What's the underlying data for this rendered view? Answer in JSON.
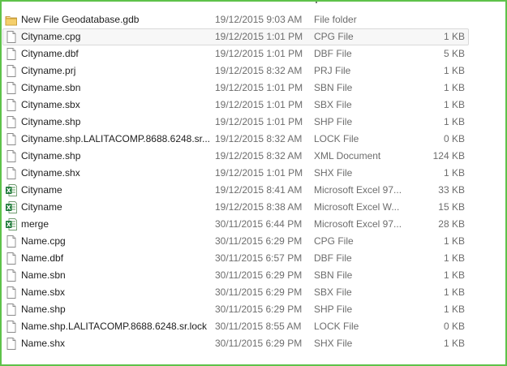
{
  "colors": {
    "frame_border": "#5ec24a",
    "selection_bg": "#f7f7f7",
    "selection_border": "#d9d9d9",
    "text_primary": "#1e1e1e",
    "text_secondary": "#6d6d6d",
    "folder": "#e8b84a",
    "excel": "#1f7a3a"
  },
  "files": [
    {
      "name": "New File Geodatabase.gdb",
      "date": "19/12/2015 9:03 AM",
      "type": "File folder",
      "size": "",
      "icon": "folder-icon",
      "selected": false
    },
    {
      "name": "Cityname.cpg",
      "date": "19/12/2015 1:01 PM",
      "type": "CPG File",
      "size": "1 KB",
      "icon": "document-icon",
      "selected": true
    },
    {
      "name": "Cityname.dbf",
      "date": "19/12/2015 1:01 PM",
      "type": "DBF File",
      "size": "5 KB",
      "icon": "document-icon",
      "selected": false
    },
    {
      "name": "Cityname.prj",
      "date": "19/12/2015 8:32 AM",
      "type": "PRJ File",
      "size": "1 KB",
      "icon": "document-icon",
      "selected": false
    },
    {
      "name": "Cityname.sbn",
      "date": "19/12/2015 1:01 PM",
      "type": "SBN File",
      "size": "1 KB",
      "icon": "document-icon",
      "selected": false
    },
    {
      "name": "Cityname.sbx",
      "date": "19/12/2015 1:01 PM",
      "type": "SBX File",
      "size": "1 KB",
      "icon": "document-icon",
      "selected": false
    },
    {
      "name": "Cityname.shp",
      "date": "19/12/2015 1:01 PM",
      "type": "SHP File",
      "size": "1 KB",
      "icon": "document-icon",
      "selected": false
    },
    {
      "name": "Cityname.shp.LALITACOMP.8688.6248.sr....",
      "date": "19/12/2015 8:32 AM",
      "type": "LOCK File",
      "size": "0 KB",
      "icon": "document-icon",
      "selected": false
    },
    {
      "name": "Cityname.shp",
      "date": "19/12/2015 8:32 AM",
      "type": "XML Document",
      "size": "124 KB",
      "icon": "document-icon",
      "selected": false
    },
    {
      "name": "Cityname.shx",
      "date": "19/12/2015 1:01 PM",
      "type": "SHX File",
      "size": "1 KB",
      "icon": "document-icon",
      "selected": false
    },
    {
      "name": "Cityname",
      "date": "19/12/2015 8:41 AM",
      "type": "Microsoft Excel 97...",
      "size": "33 KB",
      "icon": "excel-icon",
      "selected": false
    },
    {
      "name": "Cityname",
      "date": "19/12/2015 8:38 AM",
      "type": "Microsoft Excel W...",
      "size": "15 KB",
      "icon": "excel-icon",
      "selected": false
    },
    {
      "name": "merge",
      "date": "30/11/2015 6:44 PM",
      "type": "Microsoft Excel 97...",
      "size": "28 KB",
      "icon": "excel-icon",
      "selected": false
    },
    {
      "name": "Name.cpg",
      "date": "30/11/2015 6:29 PM",
      "type": "CPG File",
      "size": "1 KB",
      "icon": "document-icon",
      "selected": false
    },
    {
      "name": "Name.dbf",
      "date": "30/11/2015 6:57 PM",
      "type": "DBF File",
      "size": "1 KB",
      "icon": "document-icon",
      "selected": false
    },
    {
      "name": "Name.sbn",
      "date": "30/11/2015 6:29 PM",
      "type": "SBN File",
      "size": "1 KB",
      "icon": "document-icon",
      "selected": false
    },
    {
      "name": "Name.sbx",
      "date": "30/11/2015 6:29 PM",
      "type": "SBX File",
      "size": "1 KB",
      "icon": "document-icon",
      "selected": false
    },
    {
      "name": "Name.shp",
      "date": "30/11/2015 6:29 PM",
      "type": "SHP File",
      "size": "1 KB",
      "icon": "document-icon",
      "selected": false
    },
    {
      "name": "Name.shp.LALITACOMP.8688.6248.sr.lock",
      "date": "30/11/2015 8:55 AM",
      "type": "LOCK File",
      "size": "0 KB",
      "icon": "document-icon",
      "selected": false
    },
    {
      "name": "Name.shx",
      "date": "30/11/2015 6:29 PM",
      "type": "SHX File",
      "size": "1 KB",
      "icon": "document-icon",
      "selected": false
    }
  ]
}
